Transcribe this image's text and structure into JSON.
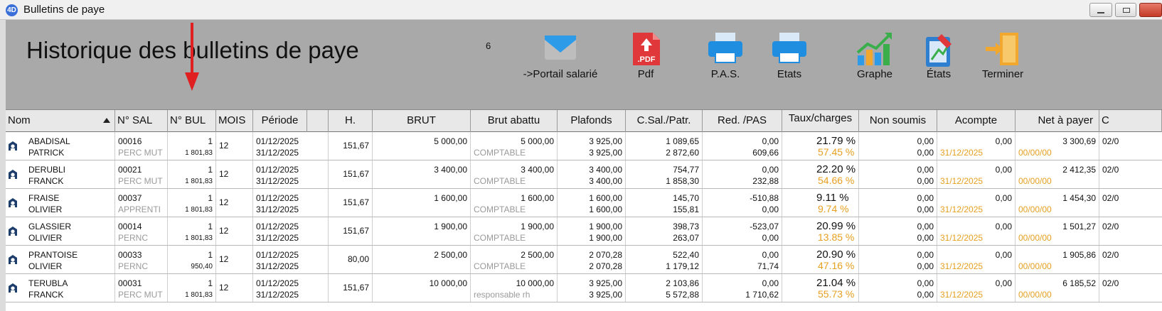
{
  "window": {
    "title": "Bulletins de paye",
    "app_icon": "4D"
  },
  "page": {
    "title": "Historique des bulletins de paye",
    "count": "6"
  },
  "toolbar": [
    {
      "label": "->Portail salarié",
      "icon": "envelope-icon"
    },
    {
      "label": "Pdf",
      "icon": "pdf-icon",
      "badge": ".PDF"
    },
    {
      "label": "P.A.S.",
      "icon": "printer-icon"
    },
    {
      "label": "Etats",
      "icon": "printer-icon"
    },
    {
      "label": "Graphe",
      "icon": "chart-icon"
    },
    {
      "label": "États",
      "icon": "report-edit-icon"
    },
    {
      "label": "Terminer",
      "icon": "exit-door-icon"
    }
  ],
  "columns": [
    "Nom",
    "N° SAL",
    "N° BUL",
    "MOIS",
    "Période",
    "H.",
    "BRUT",
    "Brut abattu",
    "Plafonds",
    "C.Sal./Patr.",
    "Red. /PAS",
    "Taux/charges",
    "Non soumis",
    "Acompte",
    "Net à payer",
    "C"
  ],
  "rows": [
    {
      "nom1": "ABADISAL",
      "nom2": "PATRICK",
      "sal": "00016",
      "sal_type": "PERC MUT",
      "bul": "1",
      "bul_amt": "1 801,83",
      "mois": "12",
      "per1": "01/12/2025",
      "per2": "31/12/2025",
      "h": "151,67",
      "brut": "5 000,00",
      "abattu": "5 000,00",
      "abattu_lbl": "COMPTABLE",
      "plaf1": "3 925,00",
      "plaf2": "3 925,00",
      "csal": "1 089,65",
      "cpat": "2 872,60",
      "red": "0,00",
      "pas": "609,66",
      "taux1": "21.79 %",
      "taux2": "57.45 %",
      "ns1": "0,00",
      "ns2": "0,00",
      "acompte": "0,00",
      "acompte_date": "31/12/2025",
      "net": "3 300,69",
      "net_date": "00/00/00",
      "c": "02/0"
    },
    {
      "nom1": "DERUBLI",
      "nom2": "FRANCK",
      "sal": "00021",
      "sal_type": "PERC MUT",
      "bul": "1",
      "bul_amt": "1 801,83",
      "mois": "12",
      "per1": "01/12/2025",
      "per2": "31/12/2025",
      "h": "151,67",
      "brut": "3 400,00",
      "abattu": "3 400,00",
      "abattu_lbl": "COMPTABLE",
      "plaf1": "3 400,00",
      "plaf2": "3 400,00",
      "csal": "754,77",
      "cpat": "1 858,30",
      "red": "0,00",
      "pas": "232,88",
      "taux1": "22.20 %",
      "taux2": "54.66 %",
      "ns1": "0,00",
      "ns2": "0,00",
      "acompte": "0,00",
      "acompte_date": "31/12/2025",
      "net": "2 412,35",
      "net_date": "00/00/00",
      "c": "02/0"
    },
    {
      "nom1": "FRAISE",
      "nom2": "OLIVIER",
      "sal": "00037",
      "sal_type": "APPRENTI",
      "bul": "1",
      "bul_amt": "1 801,83",
      "mois": "12",
      "per1": "01/12/2025",
      "per2": "31/12/2025",
      "h": "151,67",
      "brut": "1 600,00",
      "abattu": "1 600,00",
      "abattu_lbl": "COMPTABLE",
      "plaf1": "1 600,00",
      "plaf2": "1 600,00",
      "csal": "145,70",
      "cpat": "155,81",
      "red": "-510,88",
      "pas": "0,00",
      "taux1": "9.11 %",
      "taux2": "9.74 %",
      "ns1": "0,00",
      "ns2": "0,00",
      "acompte": "0,00",
      "acompte_date": "31/12/2025",
      "net": "1 454,30",
      "net_date": "00/00/00",
      "c": "02/0"
    },
    {
      "nom1": "GLASSIER",
      "nom2": "OLIVIER",
      "sal": "00014",
      "sal_type": "PERNC",
      "bul": "1",
      "bul_amt": "1 801,83",
      "mois": "12",
      "per1": "01/12/2025",
      "per2": "31/12/2025",
      "h": "151,67",
      "brut": "1 900,00",
      "abattu": "1 900,00",
      "abattu_lbl": "COMPTABLE",
      "plaf1": "1 900,00",
      "plaf2": "1 900,00",
      "csal": "398,73",
      "cpat": "263,07",
      "red": "-523,07",
      "pas": "0,00",
      "taux1": "20.99 %",
      "taux2": "13.85 %",
      "ns1": "0,00",
      "ns2": "0,00",
      "acompte": "0,00",
      "acompte_date": "31/12/2025",
      "net": "1 501,27",
      "net_date": "00/00/00",
      "c": "02/0"
    },
    {
      "nom1": "PRANTOISE",
      "nom2": "OLIVIER",
      "sal": "00033",
      "sal_type": "PERNC",
      "bul": "1",
      "bul_amt": "950,40",
      "mois": "12",
      "per1": "01/12/2025",
      "per2": "31/12/2025",
      "h": "80,00",
      "brut": "2 500,00",
      "abattu": "2 500,00",
      "abattu_lbl": "COMPTABLE",
      "plaf1": "2 070,28",
      "plaf2": "2 070,28",
      "csal": "522,40",
      "cpat": "1 179,12",
      "red": "0,00",
      "pas": "71,74",
      "taux1": "20.90 %",
      "taux2": "47.16 %",
      "ns1": "0,00",
      "ns2": "0,00",
      "acompte": "0,00",
      "acompte_date": "31/12/2025",
      "net": "1 905,86",
      "net_date": "00/00/00",
      "c": "02/0"
    },
    {
      "nom1": "TERUBLA",
      "nom2": "FRANCK",
      "sal": "00031",
      "sal_type": "PERC MUT",
      "bul": "1",
      "bul_amt": "1 801,83",
      "mois": "12",
      "per1": "01/12/2025",
      "per2": "31/12/2025",
      "h": "151,67",
      "brut": "10 000,00",
      "abattu": "10 000,00",
      "abattu_lbl": "responsable rh",
      "plaf1": "3 925,00",
      "plaf2": "3 925,00",
      "csal": "2 103,86",
      "cpat": "5 572,88",
      "red": "0,00",
      "pas": "1 710,62",
      "taux1": "21.04 %",
      "taux2": "55.73 %",
      "ns1": "0,00",
      "ns2": "0,00",
      "acompte": "0,00",
      "acompte_date": "31/12/2025",
      "net": "6 185,52",
      "net_date": "00/00/00",
      "c": "02/0"
    }
  ]
}
